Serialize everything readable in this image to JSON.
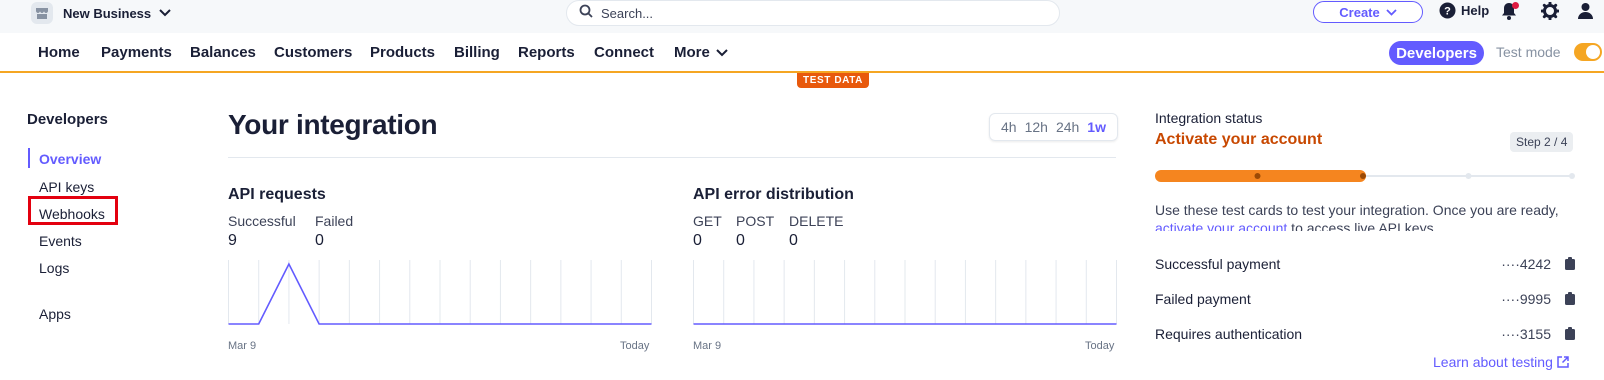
{
  "topbar": {
    "business_name": "New Business",
    "search_placeholder": "Search...",
    "create_label": "Create",
    "help_label": "Help"
  },
  "nav": {
    "items": [
      "Home",
      "Payments",
      "Balances",
      "Customers",
      "Products",
      "Billing",
      "Reports",
      "Connect",
      "More"
    ],
    "developers_label": "Developers",
    "test_mode_label": "Test mode",
    "test_mode_on": true,
    "test_data_badge": "TEST DATA"
  },
  "sidebar": {
    "title": "Developers",
    "items": [
      "Overview",
      "API keys",
      "Webhooks",
      "Events",
      "Logs",
      "Apps"
    ],
    "active": "Overview",
    "highlighted": "Webhooks"
  },
  "main": {
    "title": "Your integration",
    "ranges": [
      "4h",
      "12h",
      "24h",
      "1w"
    ],
    "selected_range": "1w"
  },
  "api_requests": {
    "title": "API requests",
    "metrics": [
      {
        "label": "Successful",
        "value": "9"
      },
      {
        "label": "Failed",
        "value": "0"
      }
    ],
    "x_start": "Mar 9",
    "x_end": "Today",
    "line_color": "#635bff"
  },
  "api_errors": {
    "title": "API error distribution",
    "metrics": [
      {
        "label": "GET",
        "value": "0"
      },
      {
        "label": "POST",
        "value": "0"
      },
      {
        "label": "DELETE",
        "value": "0"
      }
    ],
    "x_start": "Mar 9",
    "x_end": "Today",
    "line_color": "#635bff"
  },
  "chart_data": [
    {
      "type": "line",
      "title": "API requests",
      "x": [
        "Mar 9",
        "",
        "",
        "",
        "",
        "",
        "",
        "",
        "",
        "",
        "",
        "",
        "",
        "",
        "Today"
      ],
      "series": [
        {
          "name": "Successful",
          "values": [
            0,
            0,
            9,
            0,
            0,
            0,
            0,
            0,
            0,
            0,
            0,
            0,
            0,
            0,
            0
          ]
        }
      ],
      "xlabel": "",
      "ylabel": "",
      "grid": true
    },
    {
      "type": "line",
      "title": "API error distribution",
      "x": [
        "Mar 9",
        "",
        "",
        "",
        "",
        "",
        "",
        "",
        "",
        "",
        "",
        "",
        "",
        "",
        "Today"
      ],
      "series": [
        {
          "values": [
            0,
            0,
            0,
            0,
            0,
            0,
            0,
            0,
            0,
            0,
            0,
            0,
            0,
            0,
            0
          ]
        }
      ],
      "xlabel": "",
      "ylabel": "",
      "grid": true
    }
  ],
  "integration": {
    "status_label": "Integration status",
    "headline": "Activate your account",
    "step": "Step 2 / 4",
    "progress_fraction": 0.5,
    "accent_color": "#f5851f",
    "desc_prefix": "Use these test cards to test your integration. Once you are ready,",
    "desc_link": "activate your account",
    "desc_suffix": " to access live API keys.",
    "cards": [
      {
        "label": "Successful payment",
        "number": "····4242"
      },
      {
        "label": "Failed payment",
        "number": "····9995"
      },
      {
        "label": "Requires authentication",
        "number": "····3155"
      }
    ],
    "learn_link": "Learn about testing"
  }
}
